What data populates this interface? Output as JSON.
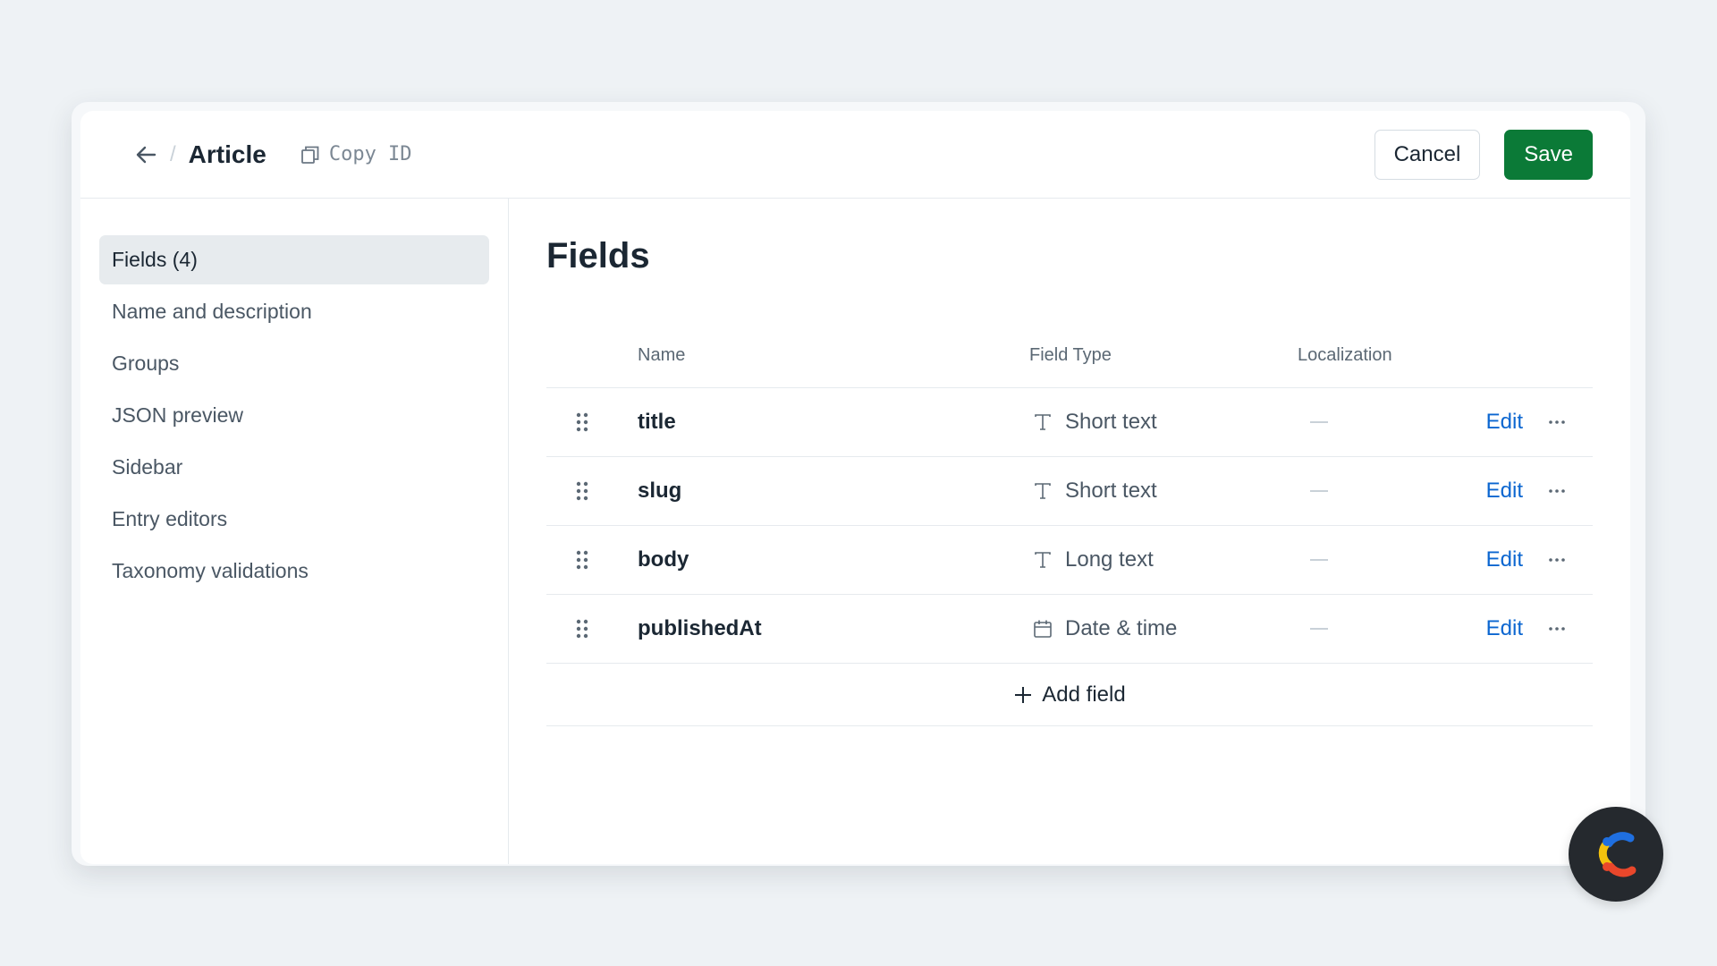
{
  "header": {
    "title": "Article",
    "copy_id_label": "Copy ID",
    "cancel_label": "Cancel",
    "save_label": "Save"
  },
  "sidebar": {
    "items": [
      {
        "label": "Fields (4)",
        "active": true
      },
      {
        "label": "Name and description"
      },
      {
        "label": "Groups"
      },
      {
        "label": "JSON preview"
      },
      {
        "label": "Sidebar"
      },
      {
        "label": "Entry editors"
      },
      {
        "label": "Taxonomy validations"
      }
    ]
  },
  "main": {
    "title": "Fields",
    "columns": {
      "name": "Name",
      "type": "Field Type",
      "localization": "Localization"
    },
    "rows": [
      {
        "name": "title",
        "type": "Short text",
        "type_icon": "text-icon",
        "edit": "Edit"
      },
      {
        "name": "slug",
        "type": "Short text",
        "type_icon": "text-icon",
        "edit": "Edit"
      },
      {
        "name": "body",
        "type": "Long text",
        "type_icon": "text-icon",
        "edit": "Edit"
      },
      {
        "name": "publishedAt",
        "type": "Date & time",
        "type_icon": "calendar-icon",
        "edit": "Edit"
      }
    ],
    "add_field_label": "Add field"
  },
  "colors": {
    "save": "#0b7a37",
    "link": "#0b66d0",
    "background": "#eef2f5"
  }
}
